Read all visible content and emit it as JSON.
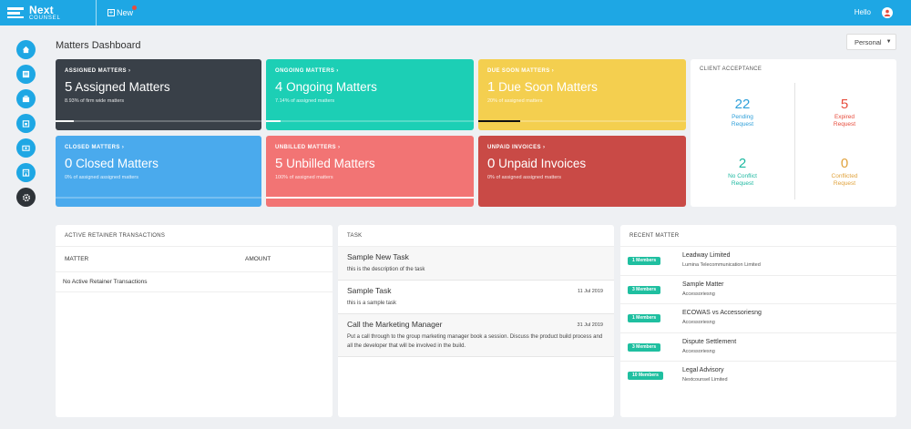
{
  "header": {
    "logo_next": "Next",
    "logo_counsel": "COUNSEL",
    "new_label": "New",
    "hello_label": "Hello"
  },
  "page": {
    "title": "Matters Dashboard",
    "scope_selected": "Personal"
  },
  "sidebar_icons": [
    "home-icon",
    "list-icon",
    "briefcase-icon",
    "calendar-icon",
    "wallet-icon",
    "building-icon",
    "settings-icon"
  ],
  "cards": [
    {
      "key": "assigned",
      "caption": "ASSIGNED MATTERS",
      "count": "5",
      "label": "Assigned Matters",
      "sub": "8.93% of firm wide matters",
      "color": "#394048",
      "progress": 0.09
    },
    {
      "key": "ongoing",
      "caption": "ONGOING MATTERS",
      "count": "4",
      "label": "Ongoing Matters",
      "sub": "7.14% of assigned matters",
      "color": "#1ccfb5",
      "progress": 0.07
    },
    {
      "key": "duesoon",
      "caption": "DUE SOON MATTERS",
      "count": "1",
      "label": "Due Soon Matters",
      "sub": "20% of assigned matters",
      "color": "#f4cf4f",
      "progress": 0.2
    },
    {
      "key": "closed",
      "caption": "CLOSED MATTERS",
      "count": "0",
      "label": "Closed Matters",
      "sub": "0% of assigned assigned matters",
      "color": "#4aaaed",
      "progress": 0
    },
    {
      "key": "unbilled",
      "caption": "UNBILLED MATTERS",
      "count": "5",
      "label": "Unbilled Matters",
      "sub": "100% of assigned matters",
      "color": "#f27474",
      "progress": 1.0
    },
    {
      "key": "invoices",
      "caption": "UNPAID INVOICES",
      "count": "0",
      "label": "Unpaid Invoices",
      "sub": "0% of assigned assigned matters",
      "color": "#c94a46",
      "progress": 0
    }
  ],
  "client_acceptance": {
    "caption": "CLIENT ACCEPTANCE",
    "stats": [
      {
        "value": "22",
        "label1": "Pending",
        "label2": "Request",
        "color": "#2e9fd9"
      },
      {
        "value": "5",
        "label1": "Expired",
        "label2": "Request",
        "color": "#e74c3c"
      },
      {
        "value": "2",
        "label1": "No Conflict",
        "label2": "Request",
        "color": "#1cb8a0"
      },
      {
        "value": "0",
        "label1": "Conflicted",
        "label2": "Request",
        "color": "#e0a23c"
      }
    ]
  },
  "retainer": {
    "title": "ACTIVE RETAINER TRANSACTIONS",
    "col_matter": "MATTER",
    "col_amount": "AMOUNT",
    "empty": "No Active Retainer Transactions"
  },
  "task": {
    "title": "TASK",
    "items": [
      {
        "title": "Sample New Task",
        "desc": "this is the description of the task",
        "date": ""
      },
      {
        "title": "Sample Task",
        "desc": "this is a sample task",
        "date": "11 Jul 2019"
      },
      {
        "title": "Call the Marketing Manager",
        "desc": "Put a call through to the group marketing manager book a session. Discuss the product build process and all the developer that will be involved in the build.",
        "date": "31 Jul 2019"
      }
    ]
  },
  "recent": {
    "title": "RECENT MATTER",
    "items": [
      {
        "badge": "1 Members",
        "title": "Leadway Limited",
        "sub": "Lumina Telecommunication Limited"
      },
      {
        "badge": "3 Members",
        "title": "Sample Matter",
        "sub": "Accessoriesng"
      },
      {
        "badge": "1 Members",
        "title": "ECOWAS vs Accessoriesng",
        "sub": "Accessoriesng"
      },
      {
        "badge": "3 Members",
        "title": "Dispute Settlement",
        "sub": "Accessoriesng"
      },
      {
        "badge": "10 Members",
        "title": "Legal Advisory",
        "sub": "Nextcounsel Limited"
      }
    ]
  }
}
